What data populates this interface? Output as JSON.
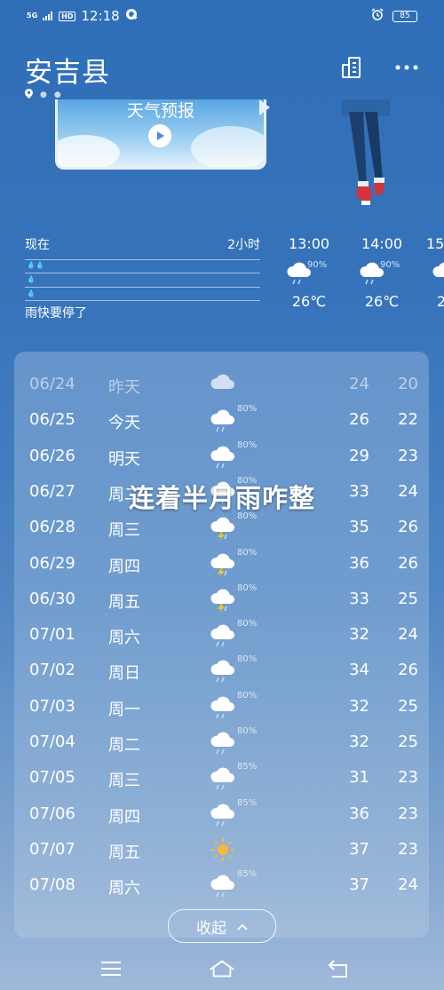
{
  "status_bar": {
    "network": "5G",
    "hd": "HD",
    "time": "12:18",
    "battery": "85"
  },
  "header": {
    "city": "安吉县"
  },
  "video": {
    "title": "天气预报"
  },
  "rain_panel": {
    "now_label": "现在",
    "end_label": "2小时",
    "message": "雨快要停了"
  },
  "hourly": [
    {
      "time": "13:00",
      "precip": "90%",
      "temp": "26℃",
      "icon": "rain-cloud-icon"
    },
    {
      "time": "14:00",
      "precip": "90%",
      "temp": "26℃",
      "icon": "rain-cloud-icon"
    },
    {
      "time": "15",
      "precip": "",
      "temp": "2",
      "icon": "rain-cloud-icon"
    }
  ],
  "forecast": [
    {
      "date": "06/24",
      "day": "昨天",
      "icon": "cloudy",
      "precip": "",
      "high": "24",
      "low": "20",
      "past": true
    },
    {
      "date": "06/25",
      "day": "今天",
      "icon": "rain",
      "precip": "80%",
      "high": "26",
      "low": "22"
    },
    {
      "date": "06/26",
      "day": "明天",
      "icon": "rain",
      "precip": "80%",
      "high": "29",
      "low": "23"
    },
    {
      "date": "06/27",
      "day": "周二",
      "icon": "rain",
      "precip": "80%",
      "high": "33",
      "low": "24"
    },
    {
      "date": "06/28",
      "day": "周三",
      "icon": "thunder",
      "precip": "80%",
      "high": "35",
      "low": "26"
    },
    {
      "date": "06/29",
      "day": "周四",
      "icon": "thunder",
      "precip": "80%",
      "high": "36",
      "low": "26"
    },
    {
      "date": "06/30",
      "day": "周五",
      "icon": "thunder",
      "precip": "80%",
      "high": "33",
      "low": "25"
    },
    {
      "date": "07/01",
      "day": "周六",
      "icon": "rain",
      "precip": "80%",
      "high": "32",
      "low": "24"
    },
    {
      "date": "07/02",
      "day": "周日",
      "icon": "rain",
      "precip": "80%",
      "high": "34",
      "low": "26"
    },
    {
      "date": "07/03",
      "day": "周一",
      "icon": "rain",
      "precip": "80%",
      "high": "32",
      "low": "25"
    },
    {
      "date": "07/04",
      "day": "周二",
      "icon": "rain",
      "precip": "80%",
      "high": "32",
      "low": "25"
    },
    {
      "date": "07/05",
      "day": "周三",
      "icon": "rain",
      "precip": "85%",
      "high": "31",
      "low": "23"
    },
    {
      "date": "07/06",
      "day": "周四",
      "icon": "rain",
      "precip": "85%",
      "high": "36",
      "low": "23"
    },
    {
      "date": "07/07",
      "day": "周五",
      "icon": "sun",
      "precip": "",
      "high": "37",
      "low": "23"
    },
    {
      "date": "07/08",
      "day": "周六",
      "icon": "rain",
      "precip": "85%",
      "high": "37",
      "low": "24"
    }
  ],
  "overlay_caption": "连着半月雨咋整",
  "collapse_label": "收起",
  "colors": {
    "bg_top": "#2f6fb7",
    "bg_bottom": "#9fb9d9",
    "sun": "#f6b93b",
    "thunder": "#f5c518",
    "shoe": "#d6323c"
  }
}
